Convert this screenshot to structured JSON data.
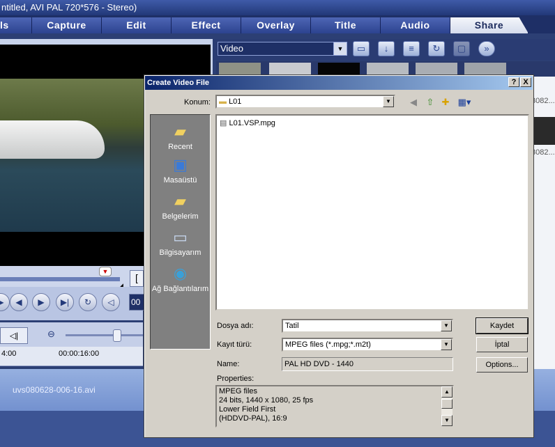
{
  "app": {
    "title": "ntitled, AVI PAL 720*576 - Stereo)",
    "tabs": [
      "ls",
      "Capture",
      "Edit",
      "Effect",
      "Overlay",
      "Title",
      "Audio",
      "Share"
    ],
    "active_tab": "Share",
    "library_select": "Video",
    "ruler_times": [
      "4:00",
      "00:00:16:00"
    ],
    "timecode_prefix": "00",
    "clip_label": "uvs080628-006-16.avi",
    "right_thumb_labels": [
      "3082...",
      "3082..."
    ],
    "colors": {
      "accent": "#2c3f74",
      "dialog_title": "#0a246a",
      "tab_active": "#f4f6fb"
    }
  },
  "dialog": {
    "title": "Create Video File",
    "help_label": "?",
    "close_label": "X",
    "location_label": "Konum:",
    "location_value": "L01",
    "places": [
      "Recent",
      "Masaüstü",
      "Belgelerim",
      "Bilgisayarım",
      "Ağ Bağlantılarım"
    ],
    "files": [
      "L01.VSP.mpg"
    ],
    "filename_label": "Dosya adı:",
    "filename_value": "Tatil",
    "filetype_label": "Kayıt türü:",
    "filetype_value": "MPEG files (*.mpg;*.m2t)",
    "name_label": "Name:",
    "name_value": "PAL    HD DVD - 1440",
    "properties_label": "Properties:",
    "properties_lines": [
      "MPEG files",
      "24 bits, 1440 x 1080, 25 fps",
      "Lower Field First",
      "(HDDVD-PAL),  16:9"
    ],
    "save_button": "Kaydet",
    "cancel_button": "İptal",
    "options_button": "Options..."
  },
  "icons": [
    "folder-icon",
    "back-icon",
    "up-folder-icon",
    "new-folder-icon",
    "view-menu-icon",
    "recent-icon",
    "desktop-icon",
    "documents-icon",
    "computer-icon",
    "network-icon",
    "file-icon"
  ]
}
